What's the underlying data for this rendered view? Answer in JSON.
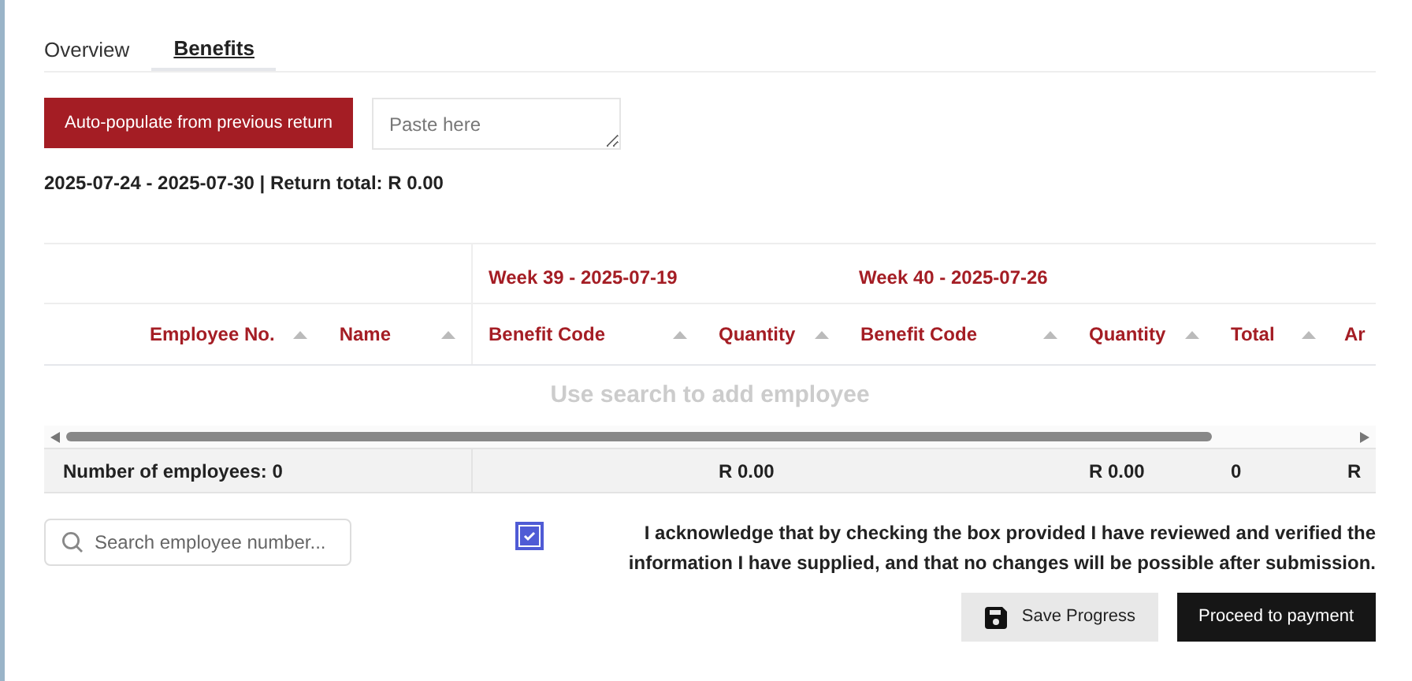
{
  "tabs": [
    {
      "label": "Overview",
      "selected": false
    },
    {
      "label": "Benefits",
      "selected": true
    }
  ],
  "autopopulate_button": "Auto-populate from previous return",
  "paste_field": {
    "placeholder": "Paste here"
  },
  "summary": "2025-07-24 - 2025-07-30 | Return total: R 0.00",
  "table": {
    "groups": [
      "Week 39 - 2025-07-19",
      "Week 40 - 2025-07-26"
    ],
    "fixed_columns": [
      {
        "label": "Employee No.",
        "sortable": true
      },
      {
        "label": "Name",
        "sortable": true
      }
    ],
    "columns": [
      {
        "label": "Benefit Code",
        "sortable": true
      },
      {
        "label": "Quantity",
        "sortable": true,
        "footer": "R 0.00"
      },
      {
        "label": "Benefit Code",
        "sortable": true
      },
      {
        "label": "Quantity",
        "sortable": true,
        "footer": "R 0.00"
      },
      {
        "label": "Total",
        "sortable": true,
        "footer": "0"
      },
      {
        "label": "Ar",
        "sortable": false,
        "footer": "R"
      }
    ],
    "empty_message": "Use search to add employee",
    "footer_fixed": "Number of employees: 0"
  },
  "search_field": {
    "placeholder": "Search employee number..."
  },
  "acknowledge": {
    "checked": true,
    "text": "I acknowledge that by checking the box provided I have reviewed and verified the information I have supplied, and that no changes will be possible after submission."
  },
  "buttons": [
    {
      "kind": "secondary",
      "label": "Save Progress"
    },
    {
      "kind": "primary",
      "label": "Proceed to payment"
    }
  ]
}
